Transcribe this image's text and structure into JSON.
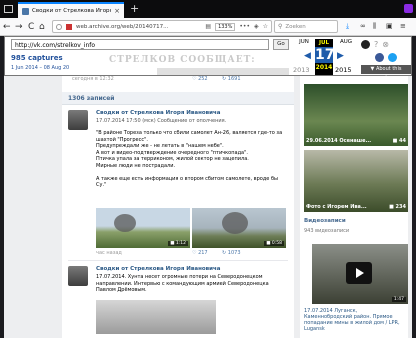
{
  "browser": {
    "tab_title": "Сводки от Стрелкова Игоря И",
    "tab_close": "×",
    "new_tab": "+",
    "url_text": "web.archive.org/web/20140717...",
    "zoom_label": "133%",
    "more_icon": "•••",
    "search_placeholder": "Zoeken",
    "nav_back": "←",
    "nav_forward": "→",
    "nav_reload": "C",
    "nav_home": "⌂"
  },
  "wayback": {
    "url_value": "http://vk.com/strelkov_info",
    "go_label": "Go",
    "captures": "985 captures",
    "capture_range": "1 Jun 2014 – 08 Aug 2018",
    "month_prev": "JUN",
    "month_cur": "JUL",
    "month_next": "AUG",
    "day": "17",
    "year_prev": "2013",
    "year_cur": "2014",
    "year_next": "2015",
    "about": "▼ About this capture",
    "watermark": "СТРЕЛКОВ СООБЩАЕТ:"
  },
  "feed": {
    "meta_date": "сегодня в 12:32",
    "meta_likes": "♡ 252",
    "meta_shares": "↻ 1691",
    "records": "1306 записей",
    "post1": {
      "author": "Сводки от Стрелкова Игоря Ивановича",
      "date": "17.07.2014 17:50 (мск) Сообщение от ополчения.",
      "text": "\"В районе Тореза только что сбили самолет Ан-26, валяется где-то за шахтой \"Прогресс\".\nПредупреждали же - не летать в \"нашем небе\".\nА вот и видео-подтверждение очередного \"птичкопада\".\nПтичка упала за терриконом, жилой сектор не зацепила.\nМирные люди не пострадали.\n\nА также еще есть информация о втором сбитом самолете, вроде бы Су.\"",
      "photo1_tag": "■ 1:12",
      "photo2_tag": "■ 0:58",
      "footer": "час назад",
      "likes": "♡ 217",
      "shares": "↻ 1073"
    },
    "post2": {
      "author": "Сводки от Стрелкова Игоря Ивановича",
      "date": "17.07.2014. Хунта несет огромные потери на Северодонецком направлении. Интервью с командующим армией Северодонецка Павлом Дрёмовым."
    }
  },
  "right": {
    "photo1_caption": "29.06.2014 Осенаше...",
    "photo1_count": "■ 44",
    "photo2_caption": "Фото с Игорем Ива...",
    "photo2_count": "■ 234",
    "videos_title": "Видеозаписи",
    "videos_count": "943 видеозаписи",
    "video_duration": "1:47",
    "video_caption": "17.07.2014 Луганск, Каменнобродский район. Прямое попадание мины в жилой дом / LPR, Lugansk"
  },
  "colors": {
    "vk_link": "#2a5885",
    "wayback_blue": "#1f5caa",
    "highlight": "#ffff00"
  }
}
